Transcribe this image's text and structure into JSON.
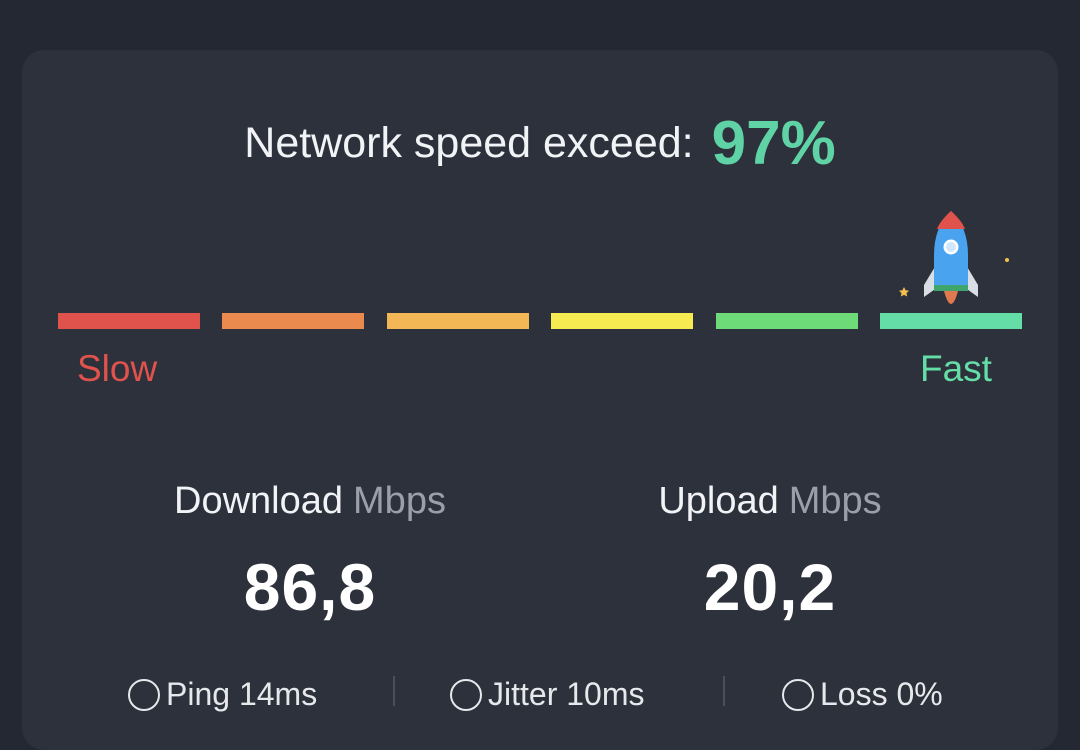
{
  "header": {
    "label": "Network speed exceed:",
    "percent": "97%"
  },
  "scale": {
    "slow_label": "Slow",
    "fast_label": "Fast",
    "segments": [
      {
        "color": "#e0524c"
      },
      {
        "color": "#ea8a4f"
      },
      {
        "color": "#f3b855"
      },
      {
        "color": "#f6ec52"
      },
      {
        "color": "#6cdb78"
      },
      {
        "color": "#64dda7"
      }
    ],
    "slow_color": "#e0524c",
    "fast_color": "#64dda7"
  },
  "download": {
    "label": "Download",
    "unit": "Mbps",
    "value": "86,8"
  },
  "upload": {
    "label": "Upload",
    "unit": "Mbps",
    "value": "20,2"
  },
  "stats": {
    "ping": "Ping 14ms",
    "jitter": "Jitter 10ms",
    "loss": "Loss 0%"
  },
  "icons": {
    "rocket": "rocket-icon",
    "ping": "ping-icon",
    "jitter": "jitter-icon",
    "loss": "loss-icon"
  }
}
